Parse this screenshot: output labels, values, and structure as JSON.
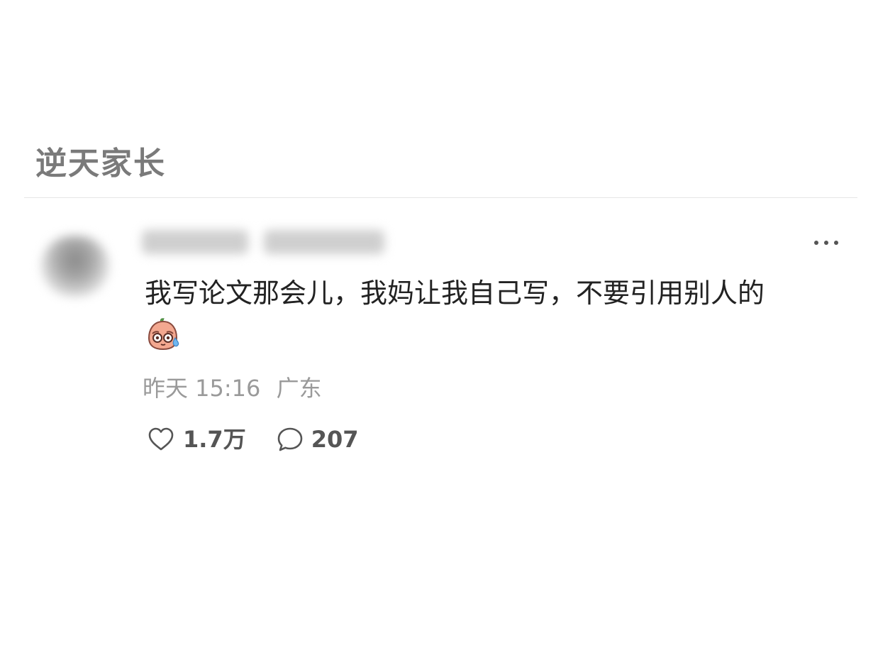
{
  "topic": {
    "title": "逆天家长"
  },
  "comment": {
    "text": "我写论文那会儿，我妈让我自己写，不要引用别人的",
    "emoji_name": "sweat-emoji",
    "time": "昨天 15:16",
    "location": "广东",
    "likes": "1.7万",
    "replies": "207"
  },
  "icons": {
    "more": "more-dots-icon",
    "like": "heart-icon",
    "reply": "comment-bubble-icon"
  },
  "colors": {
    "title": "#7a7a7a",
    "text": "#222222",
    "meta": "#9a9a9a",
    "action": "#555555",
    "divider": "#e6e6e6"
  }
}
